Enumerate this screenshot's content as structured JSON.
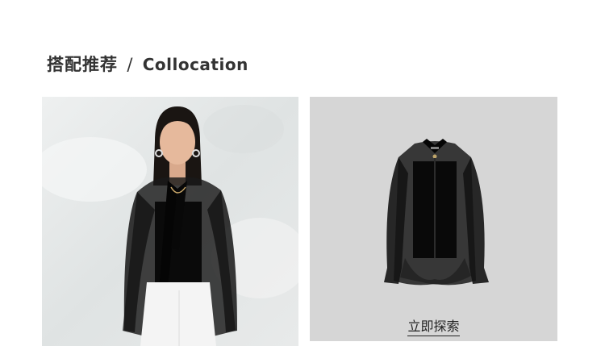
{
  "section": {
    "title_zh": "搭配推荐",
    "separator": "/",
    "title_en": "Collocation"
  },
  "product": {
    "cta_label": "立即探索"
  },
  "colors": {
    "title_text": "#333333",
    "product_bg": "#d6d6d6",
    "garment": "#0e0e0e",
    "pants": "#f4f4f4"
  },
  "images": {
    "model": "model-wearing-black-sheer-tie-neck-blouse",
    "product": "black-sheer-layered-blouse"
  }
}
